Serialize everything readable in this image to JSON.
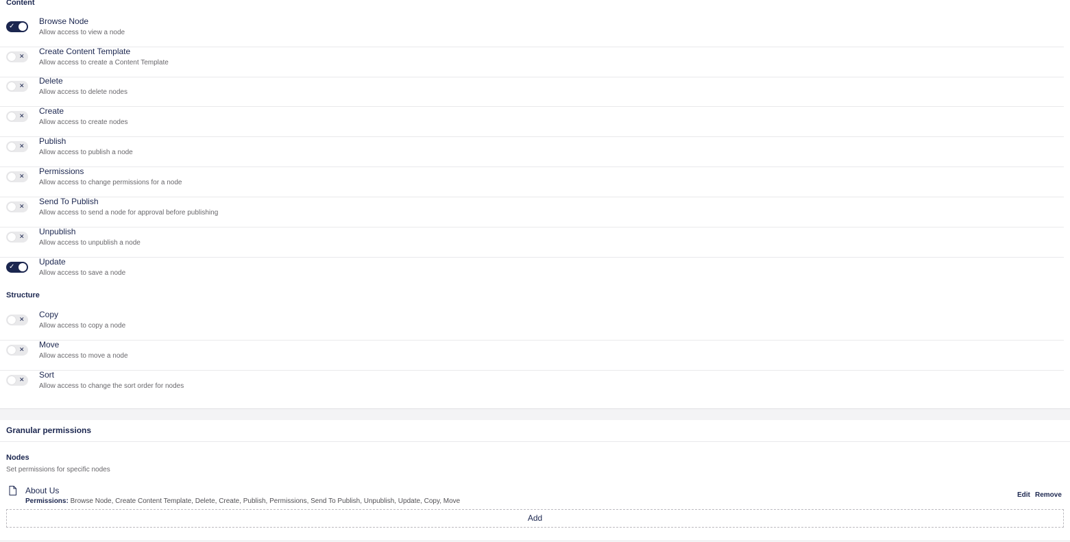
{
  "groups": [
    {
      "title": "Content",
      "items": [
        {
          "name": "Browse Node",
          "description": "Allow access to view a node",
          "enabled": true
        },
        {
          "name": "Create Content Template",
          "description": "Allow access to create a Content Template",
          "enabled": false
        },
        {
          "name": "Delete",
          "description": "Allow access to delete nodes",
          "enabled": false
        },
        {
          "name": "Create",
          "description": "Allow access to create nodes",
          "enabled": false
        },
        {
          "name": "Publish",
          "description": "Allow access to publish a node",
          "enabled": false
        },
        {
          "name": "Permissions",
          "description": "Allow access to change permissions for a node",
          "enabled": false
        },
        {
          "name": "Send To Publish",
          "description": "Allow access to send a node for approval before publishing",
          "enabled": false
        },
        {
          "name": "Unpublish",
          "description": "Allow access to unpublish a node",
          "enabled": false
        },
        {
          "name": "Update",
          "description": "Allow access to save a node",
          "enabled": true
        }
      ]
    },
    {
      "title": "Structure",
      "items": [
        {
          "name": "Copy",
          "description": "Allow access to copy a node",
          "enabled": false
        },
        {
          "name": "Move",
          "description": "Allow access to move a node",
          "enabled": false
        },
        {
          "name": "Sort",
          "description": "Allow access to change the sort order for nodes",
          "enabled": false
        }
      ]
    }
  ],
  "granular": {
    "title": "Granular permissions",
    "nodes_title": "Nodes",
    "nodes_description": "Set permissions for specific nodes",
    "entries": [
      {
        "icon": "document-icon",
        "name": "About Us",
        "permissions_label": "Permissions:",
        "permissions_value": "Browse Node, Create Content Template, Delete, Create, Publish, Permissions, Send To Publish, Unpublish, Update, Copy, Move",
        "edit_label": "Edit",
        "remove_label": "Remove"
      }
    ],
    "add_label": "Add"
  },
  "colors": {
    "accent": "#1b264f",
    "toggle_off": "#e9e9eb",
    "muted_text": "#68676b",
    "band": "#f3f3f5"
  }
}
